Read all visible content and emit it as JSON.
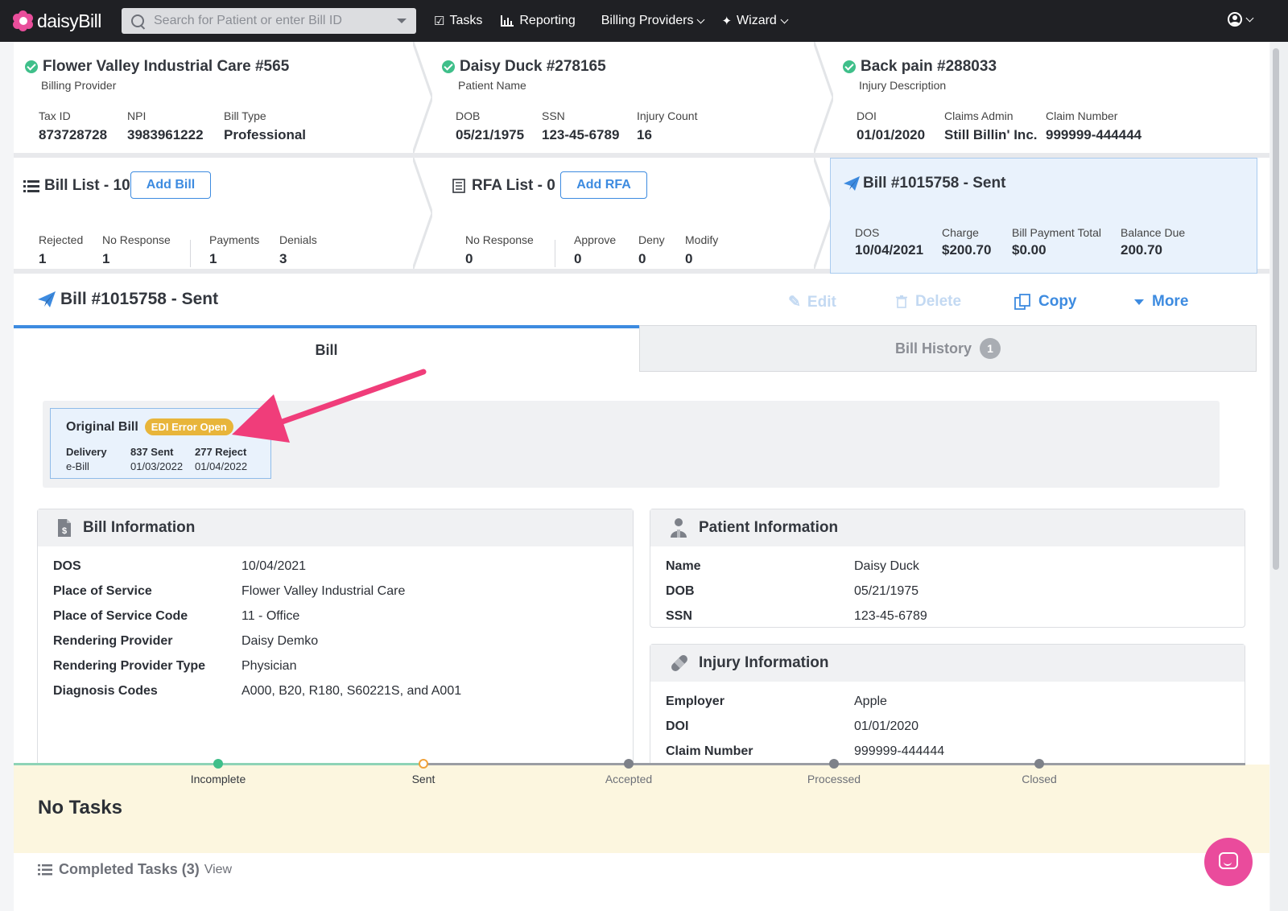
{
  "brand": {
    "name_light": "daisy",
    "name_bold": "Bill"
  },
  "search": {
    "placeholder": "Search for Patient or enter Bill ID"
  },
  "nav": {
    "tasks": "Tasks",
    "reporting": "Reporting",
    "billing_providers": "Billing Providers",
    "wizard": "Wizard"
  },
  "provider": {
    "title": "Flower Valley Industrial Care #565",
    "subtitle": "Billing Provider",
    "fields": [
      {
        "k": "Tax ID",
        "v": "873728728"
      },
      {
        "k": "NPI",
        "v": "3983961222"
      },
      {
        "k": "Bill Type",
        "v": "Professional"
      }
    ]
  },
  "patient_crumb": {
    "title": "Daisy Duck #278165",
    "subtitle": "Patient Name",
    "fields": [
      {
        "k": "DOB",
        "v": "05/21/1975"
      },
      {
        "k": "SSN",
        "v": "123-45-6789"
      },
      {
        "k": "Injury Count",
        "v": "16"
      }
    ]
  },
  "injury_crumb": {
    "title": "Back pain #288033",
    "subtitle": "Injury Description",
    "fields": [
      {
        "k": "DOI",
        "v": "01/01/2020"
      },
      {
        "k": "Claims Admin",
        "v": "Still Billin' Inc."
      },
      {
        "k": "Claim Number",
        "v": "999999-444444"
      }
    ]
  },
  "bill_list": {
    "title": "Bill List - 10",
    "add_label": "Add Bill",
    "stats": [
      {
        "k": "Rejected",
        "v": "1"
      },
      {
        "k": "No Response",
        "v": "1"
      },
      {
        "k": "Payments",
        "v": "1"
      },
      {
        "k": "Denials",
        "v": "3"
      }
    ]
  },
  "rfa_list": {
    "title": "RFA List - 0",
    "add_label": "Add RFA",
    "stats": [
      {
        "k": "No Response",
        "v": "0"
      },
      {
        "k": "Approve",
        "v": "0"
      },
      {
        "k": "Deny",
        "v": "0"
      },
      {
        "k": "Modify",
        "v": "0"
      }
    ]
  },
  "bill_summary": {
    "title": "Bill #1015758 - Sent",
    "fields": [
      {
        "k": "DOS",
        "v": "10/04/2021"
      },
      {
        "k": "Charge",
        "v": "$200.70"
      },
      {
        "k": "Bill Payment Total",
        "v": "$0.00"
      },
      {
        "k": "Balance Due",
        "v": "200.70"
      }
    ]
  },
  "bill_header": {
    "title": "Bill #1015758 - Sent",
    "edit": "Edit",
    "delete": "Delete",
    "copy": "Copy",
    "more": "More"
  },
  "tabs": {
    "bill": "Bill",
    "history": "Bill History",
    "history_count": "1"
  },
  "original_bill": {
    "title": "Original Bill",
    "badge": "EDI Error Open",
    "cols": [
      {
        "k": "Delivery",
        "v": "e-Bill"
      },
      {
        "k": "837 Sent",
        "v": "01/03/2022"
      },
      {
        "k": "277 Reject",
        "v": "01/04/2022"
      }
    ]
  },
  "bill_info": {
    "title": "Bill Information",
    "rows": [
      {
        "k": "DOS",
        "v": "10/04/2021"
      },
      {
        "k": "Place of Service",
        "v": "Flower Valley Industrial Care"
      },
      {
        "k": "Place of Service Code",
        "v": "11 - Office"
      },
      {
        "k": "Rendering Provider",
        "v": "Daisy Demko"
      },
      {
        "k": "Rendering Provider Type",
        "v": "Physician"
      },
      {
        "k": "Diagnosis Codes",
        "v": "A000, B20, R180, S60221S, and A001"
      }
    ]
  },
  "patient_info": {
    "title": "Patient Information",
    "rows": [
      {
        "k": "Name",
        "v": "Daisy Duck"
      },
      {
        "k": "DOB",
        "v": "05/21/1975"
      },
      {
        "k": "SSN",
        "v": "123-45-6789"
      }
    ]
  },
  "injury_info": {
    "title": "Injury Information",
    "rows": [
      {
        "k": "Employer",
        "v": "Apple"
      },
      {
        "k": "DOI",
        "v": "01/01/2020"
      },
      {
        "k": "Claim Number",
        "v": "999999-444444"
      }
    ]
  },
  "timeline": {
    "steps": [
      "Incomplete",
      "Sent",
      "Accepted",
      "Processed",
      "Closed"
    ],
    "current_step": "Sent"
  },
  "tasks": {
    "empty_label": "No Tasks",
    "completed_label": "Completed Tasks (3)",
    "view_label": "View"
  },
  "colors": {
    "accent": "#3d8be0",
    "success": "#3fbf8a",
    "current": "#f0a23a",
    "badge": "#e8b53a",
    "annotation_arrow": "#f03d7a",
    "nav_bg": "#1f2024"
  }
}
